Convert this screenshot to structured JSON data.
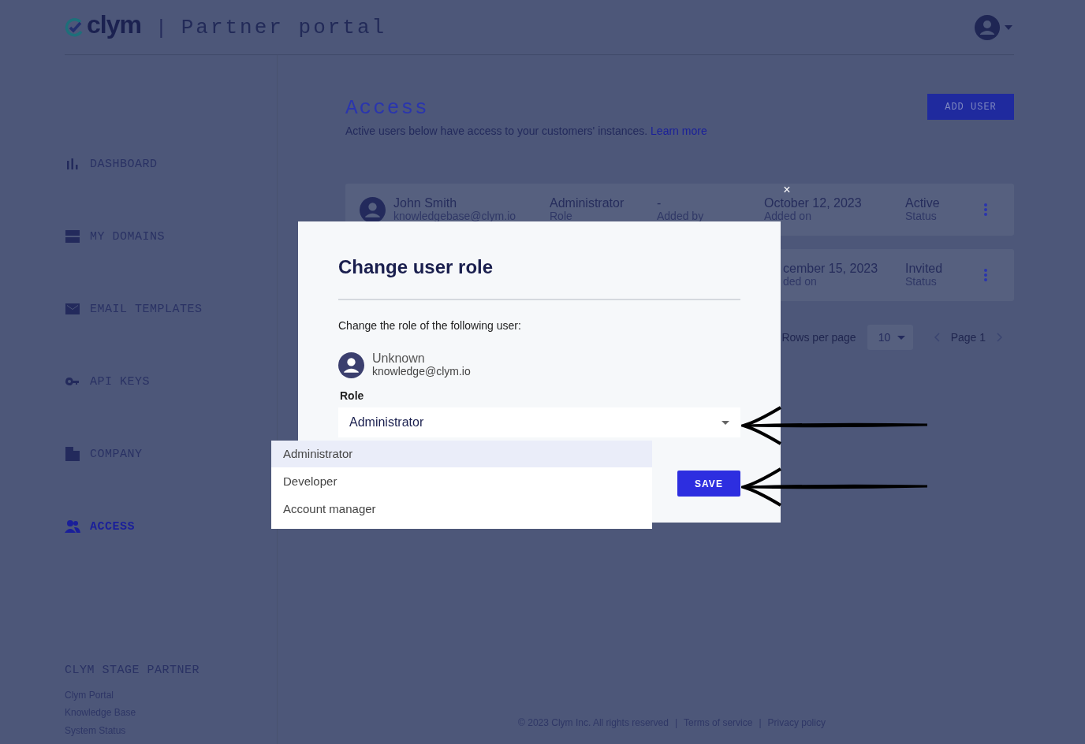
{
  "header": {
    "logo": "clym",
    "separator": "|",
    "title": "Partner portal"
  },
  "sidebar": {
    "items": [
      {
        "label": "DASHBOARD",
        "selected": false
      },
      {
        "label": "MY DOMAINS",
        "selected": false
      },
      {
        "label": "EMAIL TEMPLATES",
        "selected": false
      },
      {
        "label": "API KEYS",
        "selected": false
      },
      {
        "label": "COMPANY",
        "selected": false
      },
      {
        "label": "ACCESS",
        "selected": true
      }
    ],
    "footer_title": "CLYM STAGE PARTNER",
    "footer_links": [
      "Clym Portal",
      "Knowledge Base",
      "System Status"
    ]
  },
  "page": {
    "title": "Access",
    "subtitle": "Active users below have access to your customers' instances.",
    "learn_more": "Learn more",
    "add_user": "ADD USER"
  },
  "users": [
    {
      "name": "John Smith",
      "email": "knowledgebase@clym.io",
      "role": "Administrator",
      "role_label": "Role",
      "added_by": "-",
      "added_by_label": "Added by",
      "date": "October 12, 2023",
      "date_label": "Added on",
      "status": "Active",
      "status_label": "Status"
    },
    {
      "date": "cember 15, 2023",
      "date_label": "ded on",
      "status": "Invited",
      "status_label": "Status"
    }
  ],
  "pagination": {
    "rows_per_page_label": "Rows per page",
    "rows_per_page": "10",
    "page": "Page 1"
  },
  "modal": {
    "title": "Change user role",
    "prompt": "Change the role of the following user:",
    "user": {
      "name": "Unknown",
      "email": "knowledge@clym.io"
    },
    "role_label": "Role",
    "role_value": "Administrator",
    "save": "SAVE",
    "close": "×"
  },
  "dropdown": [
    {
      "label": "Administrator",
      "selected": true
    },
    {
      "label": "Developer",
      "selected": false
    },
    {
      "label": "Account manager",
      "selected": false
    }
  ],
  "footer": {
    "copyright": "© 2023 Clym Inc. All rights reserved",
    "separator": "|",
    "links": [
      "Terms of service",
      "Privacy policy"
    ]
  }
}
